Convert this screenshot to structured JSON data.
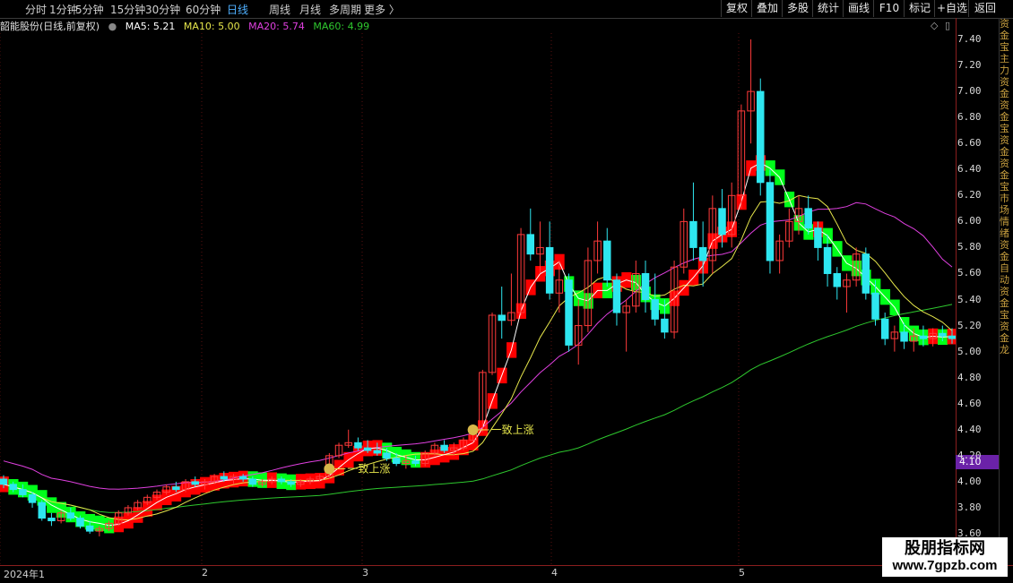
{
  "toolbar": {
    "tabs": [
      "分时",
      "1分钟",
      "5分钟",
      "15分钟",
      "30分钟",
      "60分钟",
      "日线",
      "周线",
      "月线",
      "多周期",
      "更多 〉"
    ],
    "active_tab": "日线",
    "right_buttons": [
      "复权",
      "叠加",
      "多股",
      "统计",
      "画线",
      "F10",
      "标记",
      "+自选",
      "返回"
    ]
  },
  "info": {
    "stock_title": "韶能股份(日线,前复权)",
    "ma5": "MA5: 5.21",
    "ma10": "MA10: 5.00",
    "ma20": "MA20: 5.74",
    "ma60": "MA60: 4.99"
  },
  "axis": {
    "prices": [
      "7.40",
      "7.20",
      "7.00",
      "6.80",
      "6.60",
      "6.40",
      "6.20",
      "6.00",
      "5.80",
      "5.60",
      "5.40",
      "5.20",
      "5.00",
      "4.80",
      "4.60",
      "4.40",
      "4.20",
      "4.00",
      "3.80",
      "3.60"
    ],
    "current_price": "4.10"
  },
  "dates": {
    "year_label": "2024年1",
    "months": [
      "2",
      "3",
      "4",
      "5"
    ]
  },
  "right_strip_text": "资金宝主力资金资金宝资金资金宝市场情绪资金自动资金宝资金龙",
  "annotations": [
    "一致上涨",
    "一致上涨"
  ],
  "watermark": {
    "line1": "股朋指标网",
    "line2": "www.7gpzb.com"
  },
  "colors": {
    "up": "#ff3a3a",
    "down": "#2ee6f0",
    "ma5": "#ffffff",
    "ma10": "#e6e64b",
    "ma20": "#e040e0",
    "ma60": "#2ec82e",
    "bull_band": "#ff0000",
    "bear_band": "#00ff1a"
  },
  "chart_data": {
    "type": "candlestick",
    "title": "韶能股份(日线,前复权)",
    "ylim": [
      3.6,
      7.4
    ],
    "candles_ohlc": [
      [
        4.02,
        4.05,
        3.95,
        3.98
      ],
      [
        3.98,
        4.0,
        3.92,
        3.94
      ],
      [
        3.94,
        3.98,
        3.88,
        3.9
      ],
      [
        3.9,
        3.92,
        3.8,
        3.84
      ],
      [
        3.84,
        3.86,
        3.7,
        3.72
      ],
      [
        3.72,
        3.76,
        3.66,
        3.7
      ],
      [
        3.7,
        3.78,
        3.68,
        3.76
      ],
      [
        3.76,
        3.8,
        3.7,
        3.72
      ],
      [
        3.72,
        3.74,
        3.64,
        3.66
      ],
      [
        3.66,
        3.7,
        3.6,
        3.62
      ],
      [
        3.62,
        3.66,
        3.58,
        3.64
      ],
      [
        3.64,
        3.7,
        3.62,
        3.68
      ],
      [
        3.68,
        3.78,
        3.66,
        3.76
      ],
      [
        3.76,
        3.82,
        3.74,
        3.8
      ],
      [
        3.8,
        3.86,
        3.78,
        3.84
      ],
      [
        3.84,
        3.9,
        3.82,
        3.88
      ],
      [
        3.88,
        3.94,
        3.86,
        3.92
      ],
      [
        3.92,
        3.98,
        3.9,
        3.96
      ],
      [
        3.96,
        4.0,
        3.92,
        3.94
      ],
      [
        3.94,
        4.02,
        3.92,
        4.0
      ],
      [
        4.0,
        4.04,
        3.96,
        3.98
      ],
      [
        3.98,
        4.02,
        3.94,
        4.0
      ],
      [
        4.0,
        4.06,
        3.98,
        4.04
      ],
      [
        4.04,
        4.08,
        4.0,
        4.02
      ],
      [
        4.02,
        4.06,
        3.98,
        4.04
      ],
      [
        4.04,
        4.06,
        4.0,
        4.02
      ],
      [
        4.02,
        4.04,
        3.96,
        3.98
      ],
      [
        3.98,
        4.02,
        3.96,
        4.0
      ],
      [
        4.0,
        4.04,
        3.98,
        4.02
      ],
      [
        4.02,
        4.04,
        3.98,
        4.0
      ],
      [
        4.0,
        4.02,
        3.96,
        3.98
      ],
      [
        3.98,
        4.02,
        3.96,
        4.0
      ],
      [
        4.0,
        4.04,
        3.98,
        4.02
      ],
      [
        4.02,
        4.06,
        4.0,
        4.04
      ],
      [
        4.04,
        4.22,
        4.02,
        4.2
      ],
      [
        4.2,
        4.3,
        4.18,
        4.28
      ],
      [
        4.28,
        4.4,
        4.26,
        4.3
      ],
      [
        4.3,
        4.34,
        4.24,
        4.26
      ],
      [
        4.26,
        4.32,
        4.22,
        4.24
      ],
      [
        4.24,
        4.3,
        4.2,
        4.22
      ],
      [
        4.22,
        4.26,
        4.16,
        4.18
      ],
      [
        4.18,
        4.22,
        4.12,
        4.14
      ],
      [
        4.14,
        4.2,
        4.1,
        4.16
      ],
      [
        4.16,
        4.2,
        4.12,
        4.14
      ],
      [
        4.14,
        4.24,
        4.12,
        4.22
      ],
      [
        4.22,
        4.3,
        4.2,
        4.28
      ],
      [
        4.28,
        4.32,
        4.22,
        4.24
      ],
      [
        4.24,
        4.3,
        4.2,
        4.26
      ],
      [
        4.26,
        4.34,
        4.24,
        4.32
      ],
      [
        4.32,
        4.44,
        4.3,
        4.4
      ],
      [
        4.4,
        4.86,
        4.38,
        4.84
      ],
      [
        4.84,
        5.3,
        4.82,
        5.28
      ],
      [
        5.28,
        5.5,
        5.1,
        5.24
      ],
      [
        5.24,
        5.6,
        5.2,
        5.3
      ],
      [
        5.3,
        5.95,
        5.28,
        5.9
      ],
      [
        5.9,
        6.1,
        5.7,
        5.75
      ],
      [
        5.75,
        6.0,
        5.6,
        5.8
      ],
      [
        5.8,
        6.0,
        5.4,
        5.45
      ],
      [
        5.45,
        5.7,
        5.3,
        5.55
      ],
      [
        5.55,
        5.6,
        5.0,
        5.05
      ],
      [
        5.05,
        5.4,
        4.9,
        5.2
      ],
      [
        5.2,
        5.8,
        5.15,
        5.7
      ],
      [
        5.7,
        6.0,
        5.6,
        5.85
      ],
      [
        5.85,
        5.95,
        5.5,
        5.55
      ],
      [
        5.55,
        5.6,
        5.2,
        5.3
      ],
      [
        5.3,
        5.4,
        5.0,
        5.35
      ],
      [
        5.35,
        5.7,
        5.3,
        5.6
      ],
      [
        5.6,
        5.7,
        5.3,
        5.4
      ],
      [
        5.4,
        5.6,
        5.2,
        5.25
      ],
      [
        5.25,
        5.4,
        5.1,
        5.15
      ],
      [
        5.15,
        5.7,
        5.1,
        5.65
      ],
      [
        5.65,
        6.1,
        5.6,
        6.0
      ],
      [
        6.0,
        6.3,
        5.7,
        5.8
      ],
      [
        5.8,
        6.0,
        5.5,
        5.7
      ],
      [
        5.7,
        6.2,
        5.6,
        6.1
      ],
      [
        6.1,
        6.25,
        5.8,
        5.9
      ],
      [
        5.9,
        6.3,
        5.8,
        6.2
      ],
      [
        6.2,
        6.9,
        6.1,
        6.85
      ],
      [
        6.85,
        7.4,
        6.6,
        7.0
      ],
      [
        7.0,
        7.1,
        6.2,
        6.3
      ],
      [
        6.3,
        6.4,
        5.6,
        5.7
      ],
      [
        5.7,
        5.9,
        5.6,
        5.85
      ],
      [
        5.85,
        6.1,
        5.8,
        6.0
      ],
      [
        6.0,
        6.2,
        5.9,
        6.1
      ],
      [
        6.1,
        6.2,
        5.9,
        5.95
      ],
      [
        5.95,
        6.0,
        5.7,
        5.8
      ],
      [
        5.8,
        5.9,
        5.5,
        5.6
      ],
      [
        5.6,
        5.65,
        5.4,
        5.5
      ],
      [
        5.5,
        5.6,
        5.3,
        5.55
      ],
      [
        5.55,
        5.8,
        5.5,
        5.75
      ],
      [
        5.75,
        5.8,
        5.4,
        5.45
      ],
      [
        5.45,
        5.55,
        5.2,
        5.25
      ],
      [
        5.25,
        5.3,
        5.05,
        5.1
      ],
      [
        5.1,
        5.2,
        5.0,
        5.15
      ],
      [
        5.15,
        5.22,
        5.02,
        5.08
      ],
      [
        5.08,
        5.18,
        5.0,
        5.12
      ],
      [
        5.12,
        5.2,
        5.04,
        5.1
      ],
      [
        5.1,
        5.18,
        5.04,
        5.14
      ],
      [
        5.14,
        5.2,
        5.08,
        5.12
      ],
      [
        5.12,
        5.18,
        5.06,
        5.1
      ]
    ],
    "series": [
      {
        "name": "MA5",
        "values_last": 5.21
      },
      {
        "name": "MA10",
        "values_last": 5.0
      },
      {
        "name": "MA20",
        "values_last": 5.74
      },
      {
        "name": "MA60",
        "values_last": 4.99
      }
    ]
  }
}
